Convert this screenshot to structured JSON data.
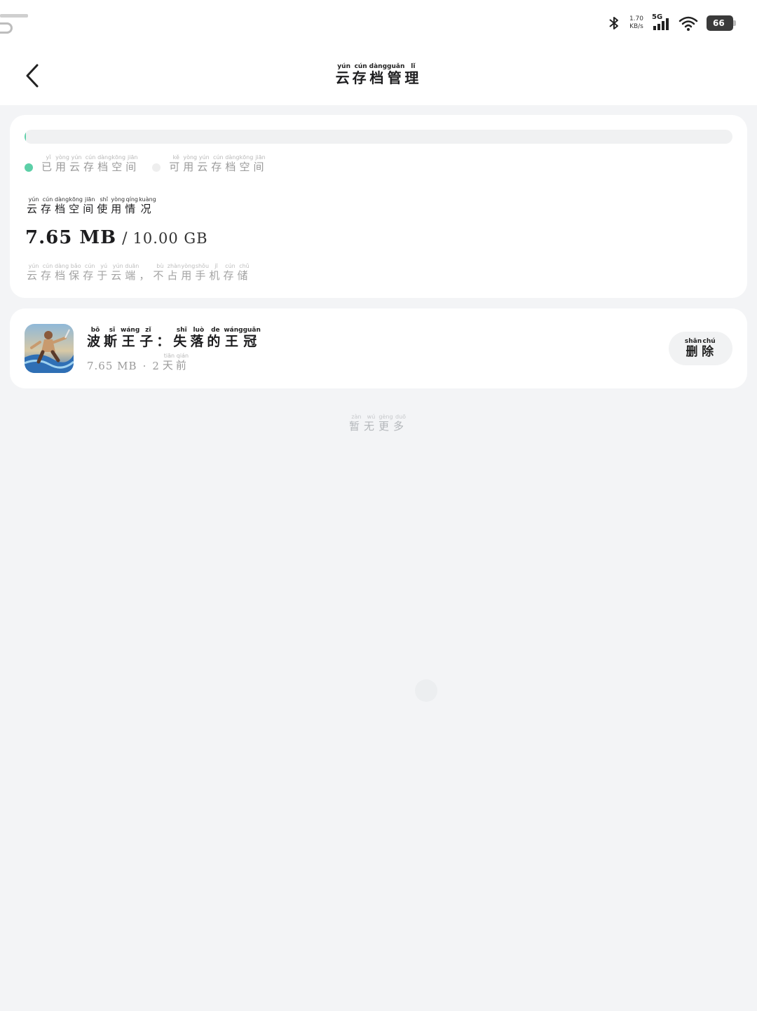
{
  "status_bar": {
    "net_speed_value": "1.70",
    "net_speed_unit": "KB/s",
    "network": "5G",
    "battery": "66",
    "icons": [
      "bluetooth-icon",
      "signal-icon",
      "wifi-icon",
      "battery-icon"
    ]
  },
  "header": {
    "title": [
      [
        "云",
        "yún"
      ],
      [
        "存",
        "cún"
      ],
      [
        "档",
        "dàng"
      ],
      [
        "管",
        "guǎn"
      ],
      [
        "理",
        "lǐ"
      ]
    ]
  },
  "usage": {
    "used_fraction": 0.0007,
    "colors": {
      "used": "#5ccfa7",
      "free": "#eeeeee"
    },
    "legend_used": [
      [
        "已",
        "yǐ"
      ],
      [
        "用",
        "yòng"
      ],
      [
        "云",
        "yún"
      ],
      [
        "存",
        "cún"
      ],
      [
        "档",
        "dàng"
      ],
      [
        "空",
        "kōng"
      ],
      [
        "间",
        "jiān"
      ]
    ],
    "legend_free": [
      [
        "可",
        "kě"
      ],
      [
        "用",
        "yòng"
      ],
      [
        "云",
        "yún"
      ],
      [
        "存",
        "cún"
      ],
      [
        "档",
        "dàng"
      ],
      [
        "空",
        "kōng"
      ],
      [
        "间",
        "jiān"
      ]
    ],
    "title": [
      [
        "云",
        "yún"
      ],
      [
        "存",
        "cún"
      ],
      [
        "档",
        "dàng"
      ],
      [
        "空",
        "kōng"
      ],
      [
        "间",
        "jiān"
      ],
      [
        "使",
        "shǐ"
      ],
      [
        "用",
        "yòng"
      ],
      [
        "情",
        "qíng"
      ],
      [
        "况",
        "kuàng"
      ]
    ],
    "used": "7.65 MB",
    "separator": "/",
    "total": "10.00 GB",
    "note": [
      [
        "云",
        "yún"
      ],
      [
        "存",
        "cún"
      ],
      [
        "档",
        "dàng"
      ],
      [
        "保",
        "bǎo"
      ],
      [
        "存",
        "cún"
      ],
      [
        "于",
        "yú"
      ],
      [
        "云",
        "yún"
      ],
      [
        "端",
        "duān"
      ],
      [
        "，",
        ""
      ],
      [
        "不",
        "bù"
      ],
      [
        "占",
        "zhàn"
      ],
      [
        "用",
        "yòng"
      ],
      [
        "手",
        "shǒu"
      ],
      [
        "机",
        "jī"
      ],
      [
        "存",
        "cún"
      ],
      [
        "储",
        "chǔ"
      ]
    ]
  },
  "saves": [
    {
      "name": [
        [
          "波",
          "bō"
        ],
        [
          "斯",
          "sī"
        ],
        [
          "王",
          "wáng"
        ],
        [
          "子",
          "zǐ"
        ],
        [
          "：",
          ""
        ],
        [
          "失",
          "shī"
        ],
        [
          "落",
          "luò"
        ],
        [
          "的",
          "de"
        ],
        [
          "王",
          "wáng"
        ],
        [
          "冠",
          "guān"
        ]
      ],
      "size": "7.65 MB",
      "dot": "·",
      "age_number": "2",
      "age_unit": [
        [
          "天",
          "tiān"
        ],
        [
          "前",
          "qián"
        ]
      ],
      "delete_label": [
        [
          "删",
          "shān"
        ],
        [
          "除",
          "chú"
        ]
      ]
    }
  ],
  "footer_note": [
    [
      "暂",
      "zàn"
    ],
    [
      "无",
      "wú"
    ],
    [
      "更",
      "gèng"
    ],
    [
      "多",
      "duō"
    ]
  ]
}
